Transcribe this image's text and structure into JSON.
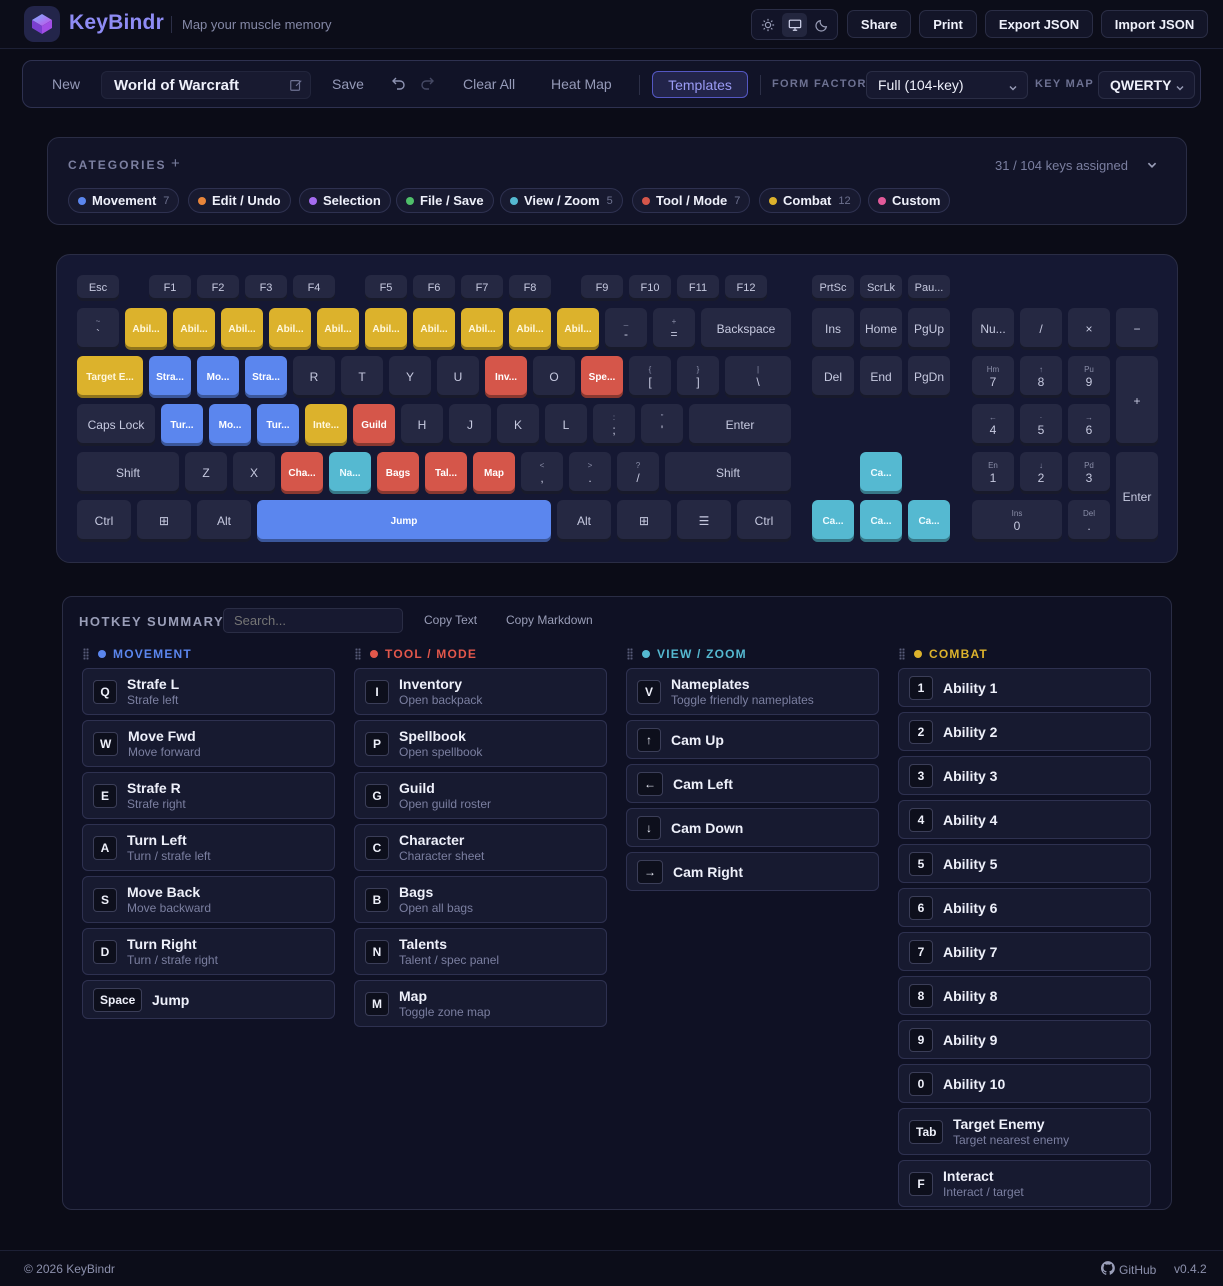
{
  "app": {
    "name": "KeyBindr",
    "tagline": "Map your muscle memory"
  },
  "header": {
    "share": "Share",
    "print": "Print",
    "export": "Export JSON",
    "import": "Import JSON",
    "theme_icons": [
      "sun-icon",
      "monitor-icon",
      "moon-icon"
    ],
    "active_theme": "monitor"
  },
  "toolbar": {
    "new_label": "New",
    "layout_title": "World of Warcraft",
    "save_label": "Save",
    "clear_label": "Clear All",
    "heatmap_label": "Heat Map",
    "templates_label": "Templates",
    "form_factor_label": "FORM FACTOR",
    "form_factor_value": "Full (104-key)",
    "keymap_label": "KEY MAP",
    "keymap_value": "QWERTY"
  },
  "categories": {
    "title": "CATEGORIES",
    "plus": "+",
    "assigned": "31 / 104 keys assigned",
    "items": [
      {
        "name": "Movement",
        "color": "#5b86ee",
        "count": "7"
      },
      {
        "name": "Edit / Undo",
        "color": "#e8853a",
        "count": ""
      },
      {
        "name": "Selection",
        "color": "#a56cf0",
        "count": ""
      },
      {
        "name": "File / Save",
        "color": "#4fbf6a",
        "count": ""
      },
      {
        "name": "View / Zoom",
        "color": "#55b9d1",
        "count": "5"
      },
      {
        "name": "Tool / Mode",
        "color": "#d5564a",
        "count": "7"
      },
      {
        "name": "Combat",
        "color": "#dcb22c",
        "count": "12"
      },
      {
        "name": "Custom",
        "color": "#e25a9a",
        "count": ""
      }
    ]
  },
  "keyboard": {
    "keys": [
      {
        "l": "Esc"
      },
      {
        "l": "F1"
      },
      {
        "l": "F2"
      },
      {
        "l": "F3"
      },
      {
        "l": "F4"
      },
      {
        "l": "F5"
      },
      {
        "l": "F6"
      },
      {
        "l": "F7"
      },
      {
        "l": "F8"
      },
      {
        "l": "F9"
      },
      {
        "l": "F10"
      },
      {
        "l": "F11"
      },
      {
        "l": "F12"
      },
      {
        "l": "PrtSc"
      },
      {
        "l": "ScrLk"
      },
      {
        "l": "Pau..."
      },
      {
        "l": "`",
        "s": "~"
      },
      {
        "l": "Abil...",
        "c": "combat"
      },
      {
        "l": "Abil...",
        "c": "combat"
      },
      {
        "l": "Abil...",
        "c": "combat"
      },
      {
        "l": "Abil...",
        "c": "combat"
      },
      {
        "l": "Abil...",
        "c": "combat"
      },
      {
        "l": "Abil...",
        "c": "combat"
      },
      {
        "l": "Abil...",
        "c": "combat"
      },
      {
        "l": "Abil...",
        "c": "combat"
      },
      {
        "l": "Abil...",
        "c": "combat"
      },
      {
        "l": "Abil...",
        "c": "combat"
      },
      {
        "l": "-",
        "s": "_"
      },
      {
        "l": "=",
        "s": "+"
      },
      {
        "l": "Backspace"
      },
      {
        "l": "Ins"
      },
      {
        "l": "Home"
      },
      {
        "l": "PgUp"
      },
      {
        "l": "Nu..."
      },
      {
        "l": "/"
      },
      {
        "l": "×"
      },
      {
        "l": "−"
      },
      {
        "l": "Target E...",
        "c": "combat"
      },
      {
        "l": "Stra...",
        "c": "move"
      },
      {
        "l": "Mo...",
        "c": "move"
      },
      {
        "l": "Stra...",
        "c": "move"
      },
      {
        "l": "R"
      },
      {
        "l": "T"
      },
      {
        "l": "Y"
      },
      {
        "l": "U"
      },
      {
        "l": "Inv...",
        "c": "tool"
      },
      {
        "l": "O"
      },
      {
        "l": "Spe...",
        "c": "tool"
      },
      {
        "l": "[",
        "s": "{"
      },
      {
        "l": "]",
        "s": "}"
      },
      {
        "l": "\\",
        "s": "|"
      },
      {
        "l": "Del"
      },
      {
        "l": "End"
      },
      {
        "l": "PgDn"
      },
      {
        "l": "7",
        "s": "Hm"
      },
      {
        "l": "8",
        "s": "↑"
      },
      {
        "l": "9",
        "s": "Pu"
      },
      {
        "l": "+"
      },
      {
        "l": "Caps Lock"
      },
      {
        "l": "Tur...",
        "c": "move"
      },
      {
        "l": "Mo...",
        "c": "move"
      },
      {
        "l": "Tur...",
        "c": "move"
      },
      {
        "l": "Inte...",
        "c": "combat"
      },
      {
        "l": "Guild",
        "c": "tool"
      },
      {
        "l": "H"
      },
      {
        "l": "J"
      },
      {
        "l": "K"
      },
      {
        "l": "L"
      },
      {
        "l": ";",
        "s": ":"
      },
      {
        "l": "'",
        "s": "\""
      },
      {
        "l": "Enter"
      },
      {
        "l": "4",
        "s": "←"
      },
      {
        "l": "5",
        "s": "·"
      },
      {
        "l": "6",
        "s": "→"
      },
      {
        "l": "Shift"
      },
      {
        "l": "Z"
      },
      {
        "l": "X"
      },
      {
        "l": "Cha...",
        "c": "tool"
      },
      {
        "l": "Na...",
        "c": "view"
      },
      {
        "l": "Bags",
        "c": "tool"
      },
      {
        "l": "Tal...",
        "c": "tool"
      },
      {
        "l": "Map",
        "c": "tool"
      },
      {
        "l": ",",
        "s": "<"
      },
      {
        "l": ".",
        "s": ">"
      },
      {
        "l": "/",
        "s": "?"
      },
      {
        "l": "Shift"
      },
      {
        "l": "Ca...",
        "c": "view"
      },
      {
        "l": "1",
        "s": "En"
      },
      {
        "l": "2",
        "s": "↓"
      },
      {
        "l": "3",
        "s": "Pd"
      },
      {
        "l": "Enter"
      },
      {
        "l": "Ctrl"
      },
      {
        "l": "⊞"
      },
      {
        "l": "Alt"
      },
      {
        "l": "Jump",
        "c": "move"
      },
      {
        "l": "Alt"
      },
      {
        "l": "⊞"
      },
      {
        "l": "☰"
      },
      {
        "l": "Ctrl"
      },
      {
        "l": "Ca...",
        "c": "view"
      },
      {
        "l": "Ca...",
        "c": "view"
      },
      {
        "l": "Ca...",
        "c": "view"
      },
      {
        "l": "0",
        "s": "Ins"
      },
      {
        "l": ".",
        "s": "Del"
      }
    ]
  },
  "summary": {
    "title": "HOTKEY SUMMARY",
    "search_placeholder": "Search...",
    "copy_text": "Copy Text",
    "copy_markdown": "Copy Markdown",
    "columns": [
      {
        "title": "MOVEMENT",
        "color": "#5b86ee",
        "items": [
          {
            "key": "Q",
            "name": "Strafe L",
            "desc": "Strafe left"
          },
          {
            "key": "W",
            "name": "Move Fwd",
            "desc": "Move forward"
          },
          {
            "key": "E",
            "name": "Strafe R",
            "desc": "Strafe right"
          },
          {
            "key": "A",
            "name": "Turn Left",
            "desc": "Turn / strafe left"
          },
          {
            "key": "S",
            "name": "Move Back",
            "desc": "Move backward"
          },
          {
            "key": "D",
            "name": "Turn Right",
            "desc": "Turn / strafe right"
          },
          {
            "key": "Space",
            "name": "Jump",
            "desc": ""
          }
        ]
      },
      {
        "title": "TOOL / MODE",
        "color": "#e2574b",
        "items": [
          {
            "key": "I",
            "name": "Inventory",
            "desc": "Open backpack"
          },
          {
            "key": "P",
            "name": "Spellbook",
            "desc": "Open spellbook"
          },
          {
            "key": "G",
            "name": "Guild",
            "desc": "Open guild roster"
          },
          {
            "key": "C",
            "name": "Character",
            "desc": "Character sheet"
          },
          {
            "key": "B",
            "name": "Bags",
            "desc": "Open all bags"
          },
          {
            "key": "N",
            "name": "Talents",
            "desc": "Talent / spec panel"
          },
          {
            "key": "M",
            "name": "Map",
            "desc": "Toggle zone map"
          }
        ]
      },
      {
        "title": "VIEW / ZOOM",
        "color": "#55b9d1",
        "items": [
          {
            "key": "V",
            "name": "Nameplates",
            "desc": "Toggle friendly nameplates"
          },
          {
            "key": "↑",
            "name": "Cam Up",
            "desc": ""
          },
          {
            "key": "←",
            "name": "Cam Left",
            "desc": ""
          },
          {
            "key": "↓",
            "name": "Cam Down",
            "desc": ""
          },
          {
            "key": "→",
            "name": "Cam Right",
            "desc": ""
          }
        ]
      },
      {
        "title": "COMBAT",
        "color": "#dcb22c",
        "items": [
          {
            "key": "1",
            "name": "Ability 1",
            "desc": ""
          },
          {
            "key": "2",
            "name": "Ability 2",
            "desc": ""
          },
          {
            "key": "3",
            "name": "Ability 3",
            "desc": ""
          },
          {
            "key": "4",
            "name": "Ability 4",
            "desc": ""
          },
          {
            "key": "5",
            "name": "Ability 5",
            "desc": ""
          },
          {
            "key": "6",
            "name": "Ability 6",
            "desc": ""
          },
          {
            "key": "7",
            "name": "Ability 7",
            "desc": ""
          },
          {
            "key": "8",
            "name": "Ability 8",
            "desc": ""
          },
          {
            "key": "9",
            "name": "Ability 9",
            "desc": ""
          },
          {
            "key": "0",
            "name": "Ability 10",
            "desc": ""
          },
          {
            "key": "Tab",
            "name": "Target Enemy",
            "desc": "Target nearest enemy"
          },
          {
            "key": "F",
            "name": "Interact",
            "desc": "Interact / target"
          }
        ]
      }
    ]
  },
  "footer": {
    "copyright": "© 2026 KeyBindr",
    "github": "GitHub",
    "version": "v0.4.2"
  }
}
